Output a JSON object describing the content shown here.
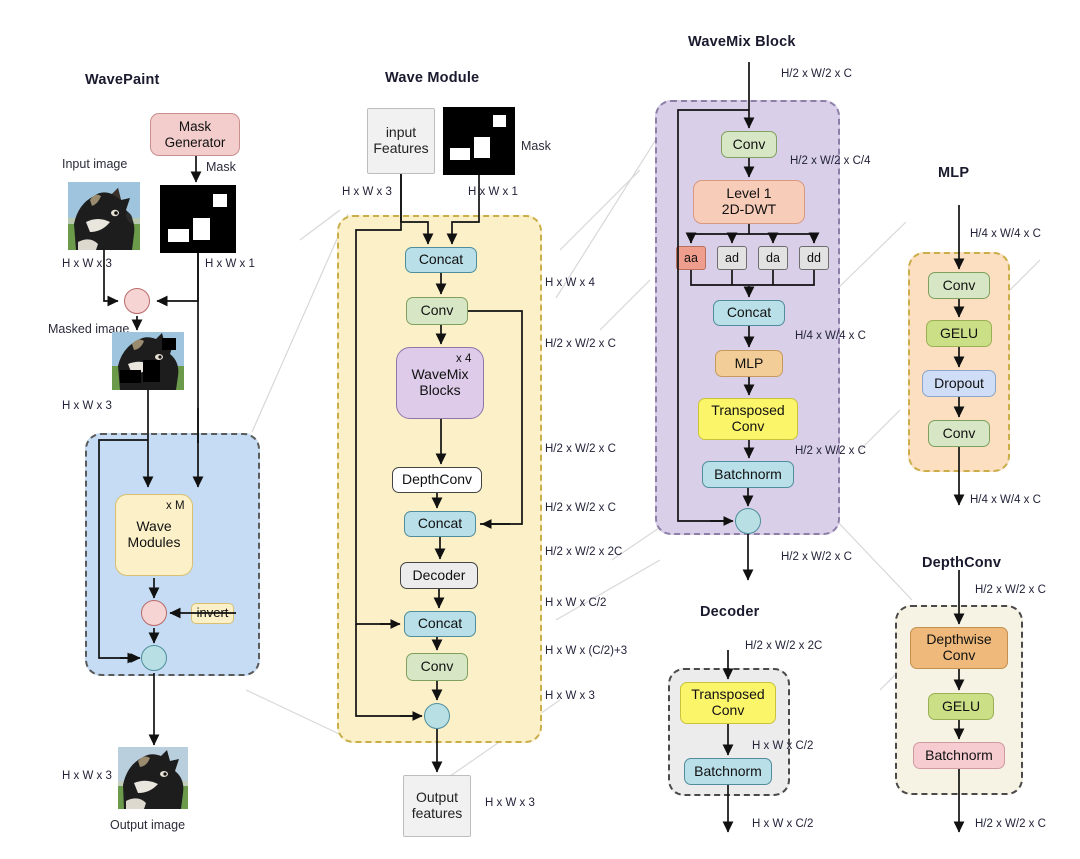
{
  "titles": {
    "wavepaint": "WavePaint",
    "wave_module": "Wave Module",
    "wavemix_block": "WaveMix Block",
    "mlp": "MLP",
    "decoder": "Decoder",
    "depthconv": "DepthConv"
  },
  "wavepaint": {
    "mask_generator": "Mask\nGenerator",
    "mask_label": "Mask",
    "input_image_label": "Input image",
    "masked_image_label": "Masked image",
    "output_image_label": "Output image",
    "wave_modules": "Wave\nModules",
    "wave_modules_repeat": "x M",
    "invert": "invert",
    "dim_input": "H x W x 3",
    "dim_mask": "H x W x 1",
    "dim_masked": "H x W x 3",
    "dim_output": "H x W x 3"
  },
  "wave_module": {
    "input_features": "input\nFeatures",
    "mask_label": "Mask",
    "output_features": "Output\nfeatures",
    "nodes": [
      {
        "label": "Concat",
        "dim": "H x W x 4"
      },
      {
        "label": "Conv",
        "dim": "H/2 x W/2 x C"
      },
      {
        "label": "WaveMix\nBlocks",
        "repeat": "x 4",
        "dim": "H/2 x W/2 x C"
      },
      {
        "label": "DepthConv",
        "dim": "H/2 x W/2 x C"
      },
      {
        "label": "Concat",
        "dim": "H/2 x W/2 x 2C"
      },
      {
        "label": "Decoder",
        "dim": "H x W x C/2"
      },
      {
        "label": "Concat",
        "dim": "H x W x (C/2)+3"
      },
      {
        "label": "Conv",
        "dim": "H x W x 3"
      }
    ],
    "dim_in_features": "H x W x 3",
    "dim_in_mask": "H x W x 1",
    "dim_out": "H x W x 3"
  },
  "wavemix_block": {
    "dim_in": "H/2 x W/2 x C",
    "nodes": [
      {
        "label": "Conv",
        "dim": "H/2 x W/2 x C/4"
      },
      {
        "label": "Level 1\n2D-DWT",
        "dim": ""
      },
      {
        "label": "Concat",
        "dim": "H/4 x W/4 x C"
      },
      {
        "label": "MLP",
        "dim": ""
      },
      {
        "label": "Transposed\nConv",
        "dim": "H/2 x W/2 x C"
      },
      {
        "label": "Batchnorm",
        "dim": ""
      }
    ],
    "subbands": [
      "aa",
      "ad",
      "da",
      "dd"
    ],
    "dim_out": "H/2 x W/2 x C"
  },
  "mlp": {
    "dim_in": "H/4 x W/4 x C",
    "nodes": [
      "Conv",
      "GELU",
      "Dropout",
      "Conv"
    ],
    "dim_out": "H/4 x W/4 x C"
  },
  "decoder": {
    "dim_in": "H/2 x W/2 x 2C",
    "nodes": [
      "Transposed\nConv",
      "Batchnorm"
    ],
    "dim_mid": "H x W x C/2",
    "dim_out": "H x W x C/2"
  },
  "depthconv": {
    "dim_in": "H/2 x W/2 x C",
    "nodes": [
      "Depthwise\nConv",
      "GELU",
      "Batchnorm"
    ],
    "dim_out": "H/2 x W/2 x C"
  },
  "colors": {
    "concat": "#b9dfe8",
    "conv": "#d7e7c6",
    "wavemix": "#ddcbe9",
    "transposed_conv": "#fbf56a",
    "mlp": "#f3cd97",
    "dwt": "#f7ccb9",
    "gelu": "#cbdf86",
    "dropout": "#cfddf6",
    "batchnorm_pink": "#f6ccd1",
    "depthwise_conv": "#efb97b",
    "mask_generator": "#f3cccc",
    "group_blue": "#c5dcf4",
    "group_yellow": "#fbf0c8",
    "group_purple": "#d9cfe9",
    "group_orange": "#fbdfc0",
    "subband_aa": "#ef9e8e"
  }
}
